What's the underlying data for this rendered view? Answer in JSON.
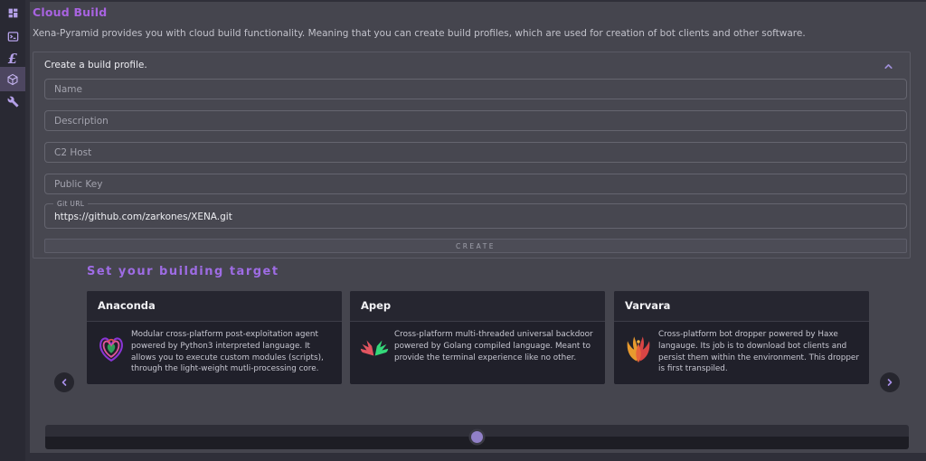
{
  "app": {
    "title": "Cloud Build",
    "description": "Xena-Pyramid provides you with cloud build functionality. Meaning that you can create build profiles, which are used for creation of bot clients and other software."
  },
  "sidebar": {
    "items": [
      {
        "icon": "dashboard-icon",
        "active": false
      },
      {
        "icon": "terminal-icon",
        "active": false
      },
      {
        "icon": "pound-icon",
        "glyph": "£",
        "active": false
      },
      {
        "icon": "cube-icon",
        "active": true
      },
      {
        "icon": "wrench-icon",
        "active": false
      }
    ]
  },
  "panel": {
    "title": "Create a build profile.",
    "collapse_icon": "chevron-up-icon",
    "fields": [
      {
        "placeholder": "Name"
      },
      {
        "placeholder": "Description"
      },
      {
        "placeholder": "C2 Host"
      },
      {
        "placeholder": "Public Key"
      }
    ],
    "git": {
      "label": "Git URL",
      "value": "https://github.com/zarkones/XENA.git"
    },
    "create_label": "CREATE"
  },
  "targets": {
    "heading": "Set your building target",
    "cards": [
      {
        "name": "Anaconda",
        "icon": "anaconda-icon",
        "description": "Modular cross-platform post-exploitation agent powered by Python3 interpreted language. It allows you to execute custom modules (scripts), through the light-weight mutli-processing core."
      },
      {
        "name": "Apep",
        "icon": "apep-wings-icon",
        "description": "Cross-platform multi-threaded universal backdoor powered by Golang compiled language. Meant to provide the terminal experience like no other."
      },
      {
        "name": "Varvara",
        "icon": "varvara-phoenix-icon",
        "description": "Cross-platform bot dropper powered by Haxe langauge. Its job is to download bot clients and persist them within the environment. This dropper is first transpiled."
      }
    ]
  },
  "carousel": {
    "prev_icon": "chevron-left-icon",
    "next_icon": "chevron-right-icon",
    "scroll_position_pct": 50
  },
  "colors": {
    "accent_title": "#a863e0",
    "accent_heading": "#9e6ce4",
    "sidebar_icon": "#b4a0e8",
    "sidebar_active_bg": "#4d4660",
    "main_bg": "#45454e",
    "card_bg": "#20202a",
    "scroll_thumb": "#9180c8"
  }
}
